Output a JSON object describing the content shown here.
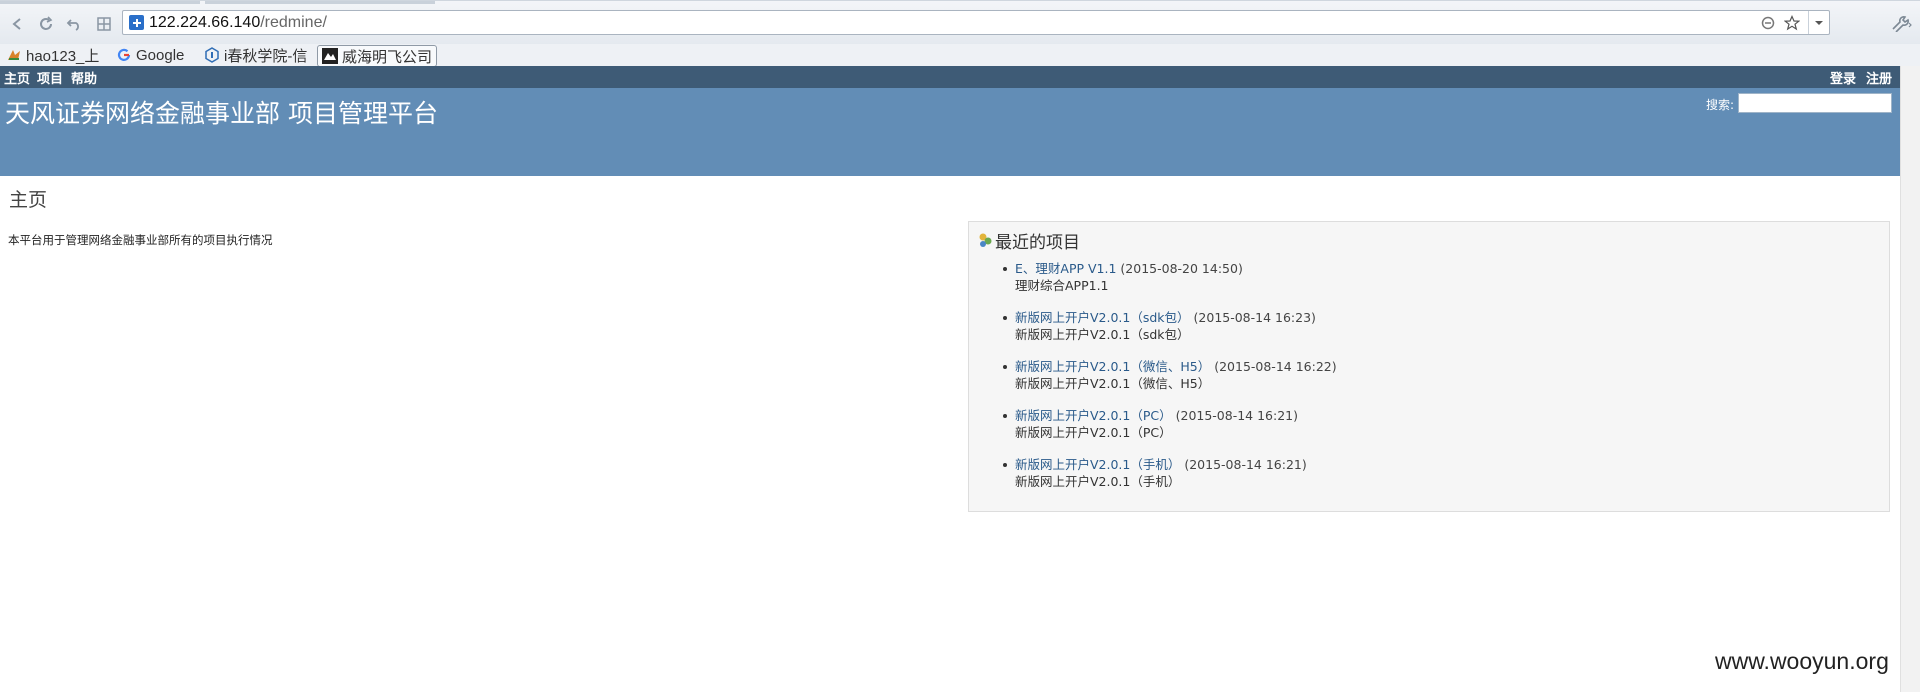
{
  "browser": {
    "url_host": "122.224.66.140",
    "url_path": "/redmine/",
    "bookmarks": [
      {
        "label": "hao123_上",
        "icon": "hao123-icon"
      },
      {
        "label": "Google",
        "icon": "google-icon"
      },
      {
        "label": "i春秋学院-信",
        "icon": "ichunqiu-icon"
      },
      {
        "label": "威海明飞公司",
        "icon": "company-icon"
      }
    ]
  },
  "top_menu": {
    "left": [
      "主页",
      "项目",
      "帮助"
    ],
    "right": [
      "登录",
      "注册"
    ]
  },
  "header": {
    "title": "天风证券网络金融事业部 项目管理平台",
    "search_label": "搜索:"
  },
  "main": {
    "heading": "主页",
    "intro": "本平台用于管理网络金融事业部所有的项目执行情况"
  },
  "recent_projects": {
    "title": "最近的项目",
    "items": [
      {
        "name": "E、理财APP V1.1",
        "date": "(2015-08-20 14:50)",
        "description": "理财综合APP1.1"
      },
      {
        "name": "新版网上开户V2.0.1（sdk包）",
        "date": "(2015-08-14 16:23)",
        "description": "新版网上开户V2.0.1（sdk包）"
      },
      {
        "name": "新版网上开户V2.0.1（微信、H5）",
        "date": "(2015-08-14 16:22)",
        "description": "新版网上开户V2.0.1（微信、H5）"
      },
      {
        "name": "新版网上开户V2.0.1（PC）",
        "date": "(2015-08-14 16:21)",
        "description": "新版网上开户V2.0.1（PC）"
      },
      {
        "name": "新版网上开户V2.0.1（手机）",
        "date": "(2015-08-14 16:21)",
        "description": "新版网上开户V2.0.1（手机）"
      }
    ]
  },
  "watermark": "www.wooyun.org"
}
